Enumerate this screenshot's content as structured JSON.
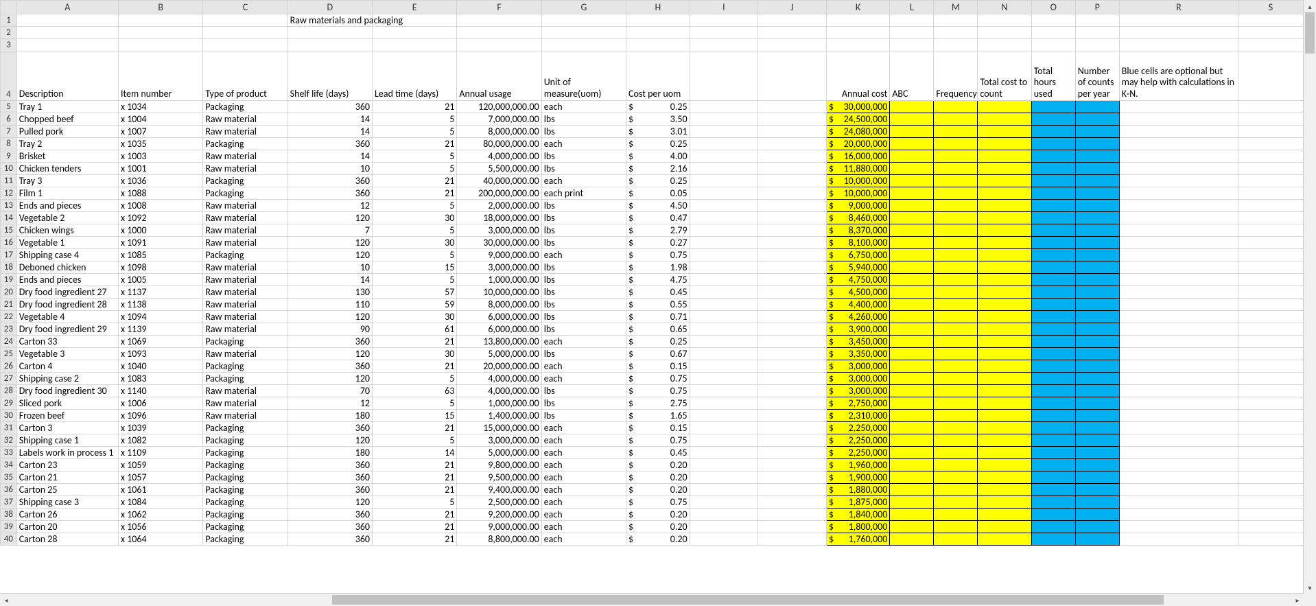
{
  "columns": [
    "A",
    "B",
    "C",
    "D",
    "E",
    "F",
    "G",
    "H",
    "I",
    "J",
    "K",
    "L",
    "M",
    "N",
    "O",
    "P",
    "R",
    "S"
  ],
  "title_cell": "Raw materials and packaging",
  "headers": {
    "A": "Description",
    "B": "Item number",
    "C": "Type of product",
    "D": "Shelf life (days)",
    "E": "Lead time (days)",
    "F": "Annual usage",
    "G": "Unit of measure(uom)",
    "H": "Cost per uom",
    "K": "Annual cost",
    "L": "ABC",
    "M": "Frequency",
    "N": "Total cost to count",
    "O": "Total hours used",
    "P": "Number of counts per year",
    "R": "Blue cells are optional but may help with calculations in K-N."
  },
  "rows": [
    {
      "r": 5,
      "desc": "Tray 1",
      "item": "x 1034",
      "type": "Packaging",
      "shelf": "360",
      "lead": "21",
      "usage": "120,000,000.00",
      "uom": "each",
      "cost": "0.25",
      "annual": "30,000,000"
    },
    {
      "r": 6,
      "desc": "Chopped beef",
      "item": "x 1004",
      "type": "Raw material",
      "shelf": "14",
      "lead": "5",
      "usage": "7,000,000.00",
      "uom": "lbs",
      "cost": "3.50",
      "annual": "24,500,000"
    },
    {
      "r": 7,
      "desc": "Pulled pork",
      "item": "x 1007",
      "type": "Raw material",
      "shelf": "14",
      "lead": "5",
      "usage": "8,000,000.00",
      "uom": "lbs",
      "cost": "3.01",
      "annual": "24,080,000"
    },
    {
      "r": 8,
      "desc": "Tray 2",
      "item": "x 1035",
      "type": "Packaging",
      "shelf": "360",
      "lead": "21",
      "usage": "80,000,000.00",
      "uom": "each",
      "cost": "0.25",
      "annual": "20,000,000"
    },
    {
      "r": 9,
      "desc": "Brisket",
      "item": "x 1003",
      "type": "Raw material",
      "shelf": "14",
      "lead": "5",
      "usage": "4,000,000.00",
      "uom": "lbs",
      "cost": "4.00",
      "annual": "16,000,000"
    },
    {
      "r": 10,
      "desc": "Chicken tenders",
      "item": "x 1001",
      "type": "Raw material",
      "shelf": "10",
      "lead": "5",
      "usage": "5,500,000.00",
      "uom": "lbs",
      "cost": "2.16",
      "annual": "11,880,000"
    },
    {
      "r": 11,
      "desc": "Tray 3",
      "item": "x 1036",
      "type": "Packaging",
      "shelf": "360",
      "lead": "21",
      "usage": "40,000,000.00",
      "uom": "each",
      "cost": "0.25",
      "annual": "10,000,000"
    },
    {
      "r": 12,
      "desc": "Film 1",
      "item": "x 1088",
      "type": "Packaging",
      "shelf": "360",
      "lead": "21",
      "usage": "200,000,000.00",
      "uom": "each print",
      "cost": "0.05",
      "annual": "10,000,000"
    },
    {
      "r": 13,
      "desc": "Ends and pieces",
      "item": "x 1008",
      "type": "Raw material",
      "shelf": "12",
      "lead": "5",
      "usage": "2,000,000.00",
      "uom": "lbs",
      "cost": "4.50",
      "annual": "9,000,000"
    },
    {
      "r": 14,
      "desc": "Vegetable 2",
      "item": "x 1092",
      "type": "Raw material",
      "shelf": "120",
      "lead": "30",
      "usage": "18,000,000.00",
      "uom": "lbs",
      "cost": "0.47",
      "annual": "8,460,000"
    },
    {
      "r": 15,
      "desc": "Chicken wings",
      "item": "x 1000",
      "type": "Raw material",
      "shelf": "7",
      "lead": "5",
      "usage": "3,000,000.00",
      "uom": "lbs",
      "cost": "2.79",
      "annual": "8,370,000"
    },
    {
      "r": 16,
      "desc": "Vegetable 1",
      "item": "x 1091",
      "type": "Raw material",
      "shelf": "120",
      "lead": "30",
      "usage": "30,000,000.00",
      "uom": "lbs",
      "cost": "0.27",
      "annual": "8,100,000"
    },
    {
      "r": 17,
      "desc": "Shipping case 4",
      "item": "x 1085",
      "type": "Packaging",
      "shelf": "120",
      "lead": "5",
      "usage": "9,000,000.00",
      "uom": "each",
      "cost": "0.75",
      "annual": "6,750,000"
    },
    {
      "r": 18,
      "desc": "Deboned chicken",
      "item": "x 1098",
      "type": "Raw material",
      "shelf": "10",
      "lead": "15",
      "usage": "3,000,000.00",
      "uom": "lbs",
      "cost": "1.98",
      "annual": "5,940,000"
    },
    {
      "r": 19,
      "desc": "Ends and pieces",
      "item": "x 1005",
      "type": "Raw material",
      "shelf": "14",
      "lead": "5",
      "usage": "1,000,000.00",
      "uom": "lbs",
      "cost": "4.75",
      "annual": "4,750,000"
    },
    {
      "r": 20,
      "desc": "Dry food ingredient 27",
      "item": "x 1137",
      "type": "Raw material",
      "shelf": "130",
      "lead": "57",
      "usage": "10,000,000.00",
      "uom": "lbs",
      "cost": "0.45",
      "annual": "4,500,000"
    },
    {
      "r": 21,
      "desc": "Dry food ingredient 28",
      "item": "x 1138",
      "type": "Raw material",
      "shelf": "110",
      "lead": "59",
      "usage": "8,000,000.00",
      "uom": "lbs",
      "cost": "0.55",
      "annual": "4,400,000"
    },
    {
      "r": 22,
      "desc": "Vegetable 4",
      "item": "x 1094",
      "type": "Raw material",
      "shelf": "120",
      "lead": "30",
      "usage": "6,000,000.00",
      "uom": "lbs",
      "cost": "0.71",
      "annual": "4,260,000"
    },
    {
      "r": 23,
      "desc": "Dry food ingredient 29",
      "item": "x 1139",
      "type": "Raw material",
      "shelf": "90",
      "lead": "61",
      "usage": "6,000,000.00",
      "uom": "lbs",
      "cost": "0.65",
      "annual": "3,900,000"
    },
    {
      "r": 24,
      "desc": "Carton 33",
      "item": "x 1069",
      "type": "Packaging",
      "shelf": "360",
      "lead": "21",
      "usage": "13,800,000.00",
      "uom": "each",
      "cost": "0.25",
      "annual": "3,450,000"
    },
    {
      "r": 25,
      "desc": "Vegetable 3",
      "item": "x 1093",
      "type": "Raw material",
      "shelf": "120",
      "lead": "30",
      "usage": "5,000,000.00",
      "uom": "lbs",
      "cost": "0.67",
      "annual": "3,350,000"
    },
    {
      "r": 26,
      "desc": "Carton 4",
      "item": "x 1040",
      "type": "Packaging",
      "shelf": "360",
      "lead": "21",
      "usage": "20,000,000.00",
      "uom": "each",
      "cost": "0.15",
      "annual": "3,000,000"
    },
    {
      "r": 27,
      "desc": "Shipping case 2",
      "item": "x 1083",
      "type": "Packaging",
      "shelf": "120",
      "lead": "5",
      "usage": "4,000,000.00",
      "uom": "each",
      "cost": "0.75",
      "annual": "3,000,000"
    },
    {
      "r": 28,
      "desc": "Dry food ingredient 30",
      "item": "x 1140",
      "type": "Raw material",
      "shelf": "70",
      "lead": "63",
      "usage": "4,000,000.00",
      "uom": "lbs",
      "cost": "0.75",
      "annual": "3,000,000"
    },
    {
      "r": 29,
      "desc": "Sliced pork",
      "item": "x 1006",
      "type": "Raw material",
      "shelf": "12",
      "lead": "5",
      "usage": "1,000,000.00",
      "uom": "lbs",
      "cost": "2.75",
      "annual": "2,750,000"
    },
    {
      "r": 30,
      "desc": "Frozen beef",
      "item": "x 1096",
      "type": "Raw material",
      "shelf": "180",
      "lead": "15",
      "usage": "1,400,000.00",
      "uom": "lbs",
      "cost": "1.65",
      "annual": "2,310,000"
    },
    {
      "r": 31,
      "desc": "Carton 3",
      "item": "x 1039",
      "type": "Packaging",
      "shelf": "360",
      "lead": "21",
      "usage": "15,000,000.00",
      "uom": "each",
      "cost": "0.15",
      "annual": "2,250,000"
    },
    {
      "r": 32,
      "desc": "Shipping case 1",
      "item": "x 1082",
      "type": "Packaging",
      "shelf": "120",
      "lead": "5",
      "usage": "3,000,000.00",
      "uom": "each",
      "cost": "0.75",
      "annual": "2,250,000"
    },
    {
      "r": 33,
      "desc": "Labels work in process 1",
      "item": "x 1109",
      "type": "Packaging",
      "shelf": "180",
      "lead": "14",
      "usage": "5,000,000.00",
      "uom": "each",
      "cost": "0.45",
      "annual": "2,250,000"
    },
    {
      "r": 34,
      "desc": "Carton 23",
      "item": "x 1059",
      "type": "Packaging",
      "shelf": "360",
      "lead": "21",
      "usage": "9,800,000.00",
      "uom": "each",
      "cost": "0.20",
      "annual": "1,960,000"
    },
    {
      "r": 35,
      "desc": "Carton 21",
      "item": "x 1057",
      "type": "Packaging",
      "shelf": "360",
      "lead": "21",
      "usage": "9,500,000.00",
      "uom": "each",
      "cost": "0.20",
      "annual": "1,900,000"
    },
    {
      "r": 36,
      "desc": "Carton 25",
      "item": "x 1061",
      "type": "Packaging",
      "shelf": "360",
      "lead": "21",
      "usage": "9,400,000.00",
      "uom": "each",
      "cost": "0.20",
      "annual": "1,880,000"
    },
    {
      "r": 37,
      "desc": "Shipping case 3",
      "item": "x 1084",
      "type": "Packaging",
      "shelf": "120",
      "lead": "5",
      "usage": "2,500,000.00",
      "uom": "each",
      "cost": "0.75",
      "annual": "1,875,000"
    },
    {
      "r": 38,
      "desc": "Carton 26",
      "item": "x 1062",
      "type": "Packaging",
      "shelf": "360",
      "lead": "21",
      "usage": "9,200,000.00",
      "uom": "each",
      "cost": "0.20",
      "annual": "1,840,000"
    },
    {
      "r": 39,
      "desc": "Carton 20",
      "item": "x 1056",
      "type": "Packaging",
      "shelf": "360",
      "lead": "21",
      "usage": "9,000,000.00",
      "uom": "each",
      "cost": "0.20",
      "annual": "1,800,000"
    },
    {
      "r": 40,
      "desc": "Carton 28",
      "item": "x 1064",
      "type": "Packaging",
      "shelf": "360",
      "lead": "21",
      "usage": "8,800,000.00",
      "uom": "each",
      "cost": "0.20",
      "annual": "1,760,000"
    }
  ],
  "scroll": {
    "up": "▴",
    "down": "▾",
    "left": "◂",
    "right": "▸"
  }
}
